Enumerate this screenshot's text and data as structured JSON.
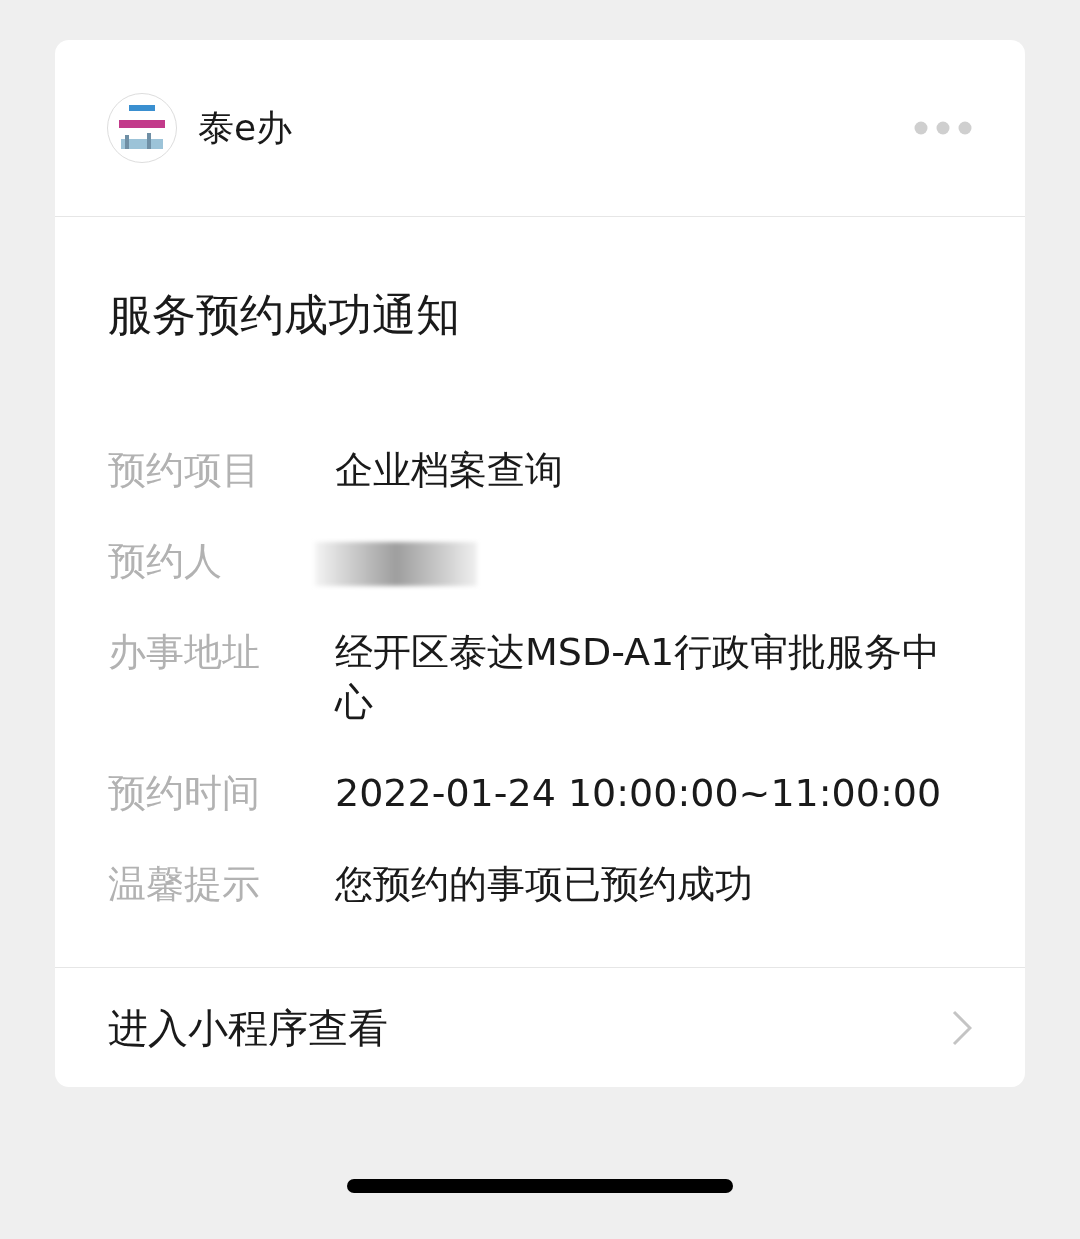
{
  "header": {
    "name": "泰e办"
  },
  "title": "服务预约成功通知",
  "fields": [
    {
      "label": "预约项目",
      "kind": "text",
      "value": "企业档案查询"
    },
    {
      "label": "预约人",
      "kind": "redacted"
    },
    {
      "label": "办事地址",
      "kind": "text",
      "value": "经开区泰达MSD-A1行政审批服务中心"
    },
    {
      "label": "预约时间",
      "kind": "text",
      "value": "2022-01-24 10:00:00~11:00:00"
    },
    {
      "label": "温馨提示",
      "kind": "text",
      "value": "您预约的事项已预约成功"
    }
  ],
  "footer": {
    "link": "进入小程序查看"
  }
}
